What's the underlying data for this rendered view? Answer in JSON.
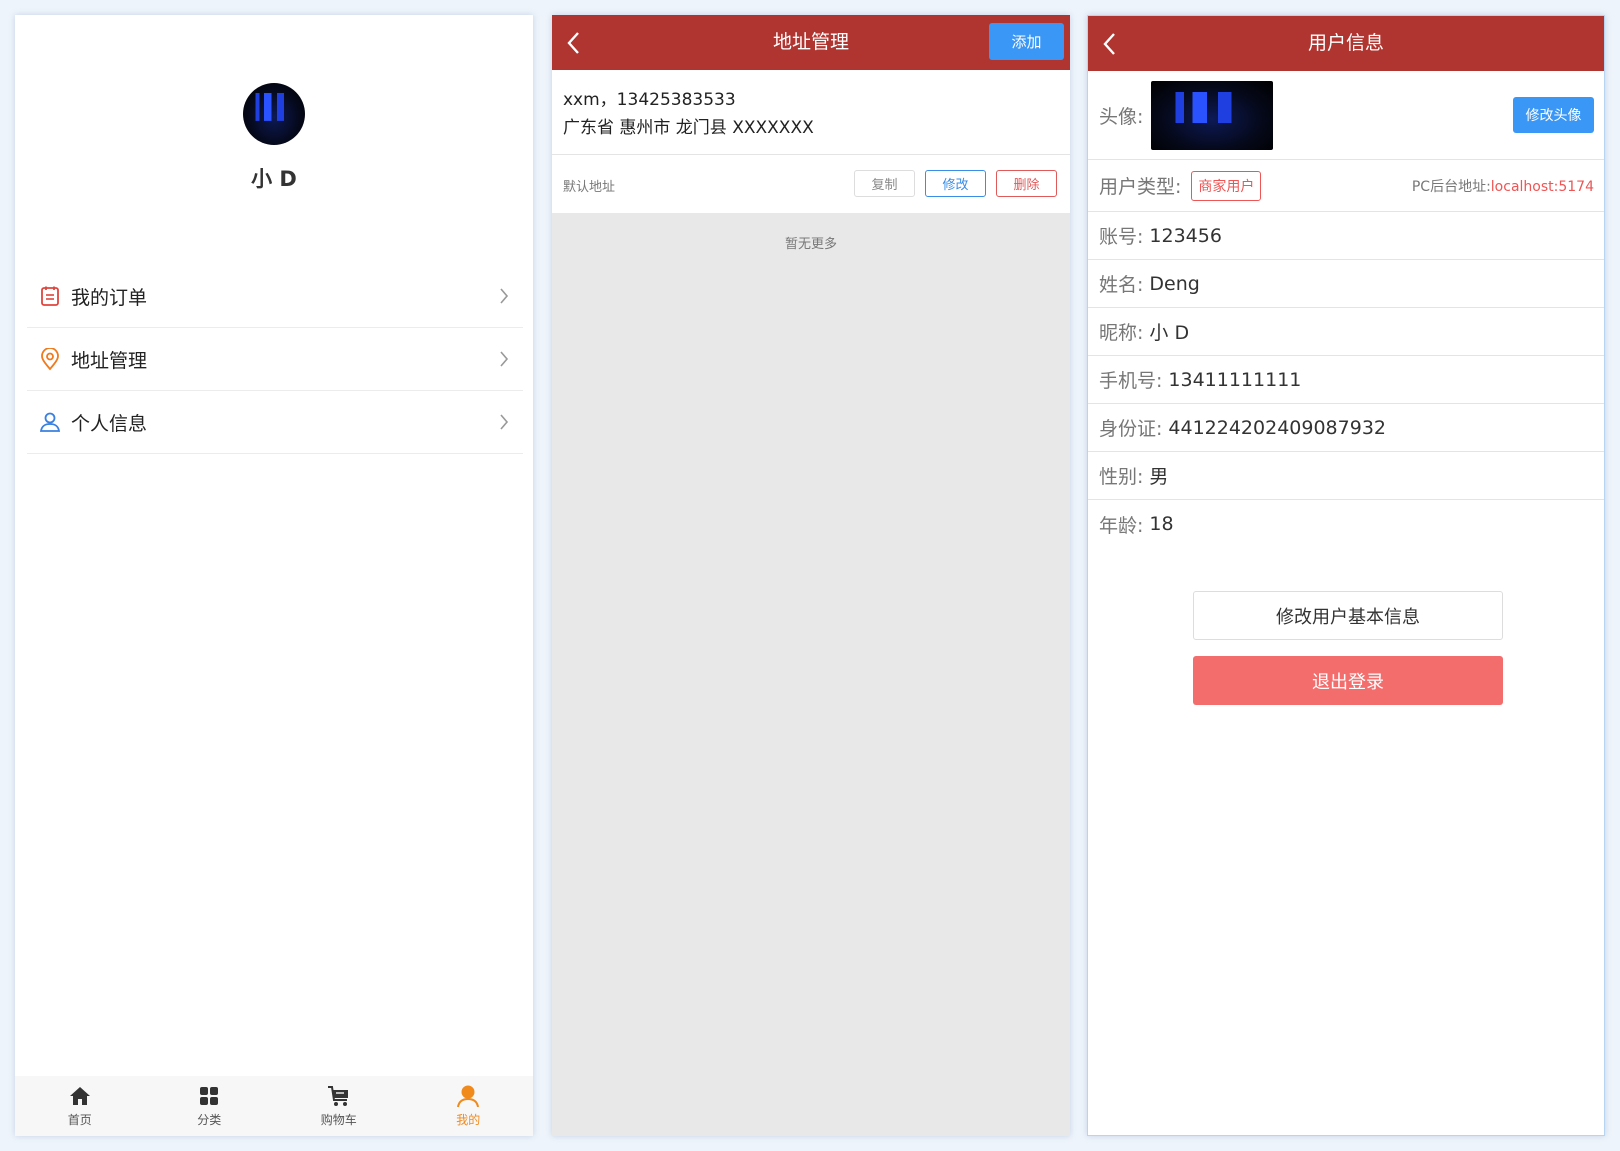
{
  "profile": {
    "username": "小 D",
    "menu": [
      {
        "label": "我的订单",
        "icon": "order-list-icon"
      },
      {
        "label": "地址管理",
        "icon": "location-pin-icon"
      },
      {
        "label": "个人信息",
        "icon": "person-icon"
      }
    ],
    "tabs": [
      {
        "label": "首页",
        "icon": "home-icon"
      },
      {
        "label": "分类",
        "icon": "grid-icon"
      },
      {
        "label": "购物车",
        "icon": "cart-icon"
      },
      {
        "label": "我的",
        "icon": "user-icon",
        "active": true
      }
    ]
  },
  "address_page": {
    "title": "地址管理",
    "add_label": "添加",
    "address": {
      "contact": "xxm，13425383533",
      "location": "广东省 惠州市 龙门县 XXXXXXX",
      "default_label": "默认地址"
    },
    "actions": {
      "copy": "复制",
      "edit": "修改",
      "delete": "删除"
    },
    "no_more": "暂无更多"
  },
  "user_page": {
    "title": "用户信息",
    "avatar_label": "头像:",
    "change_avatar": "修改头像",
    "type_label": "用户类型:",
    "type_value": "商家用户",
    "pc_label": "PC后台地址:",
    "pc_link": "localhost:5174",
    "fields": [
      {
        "label": "账号:",
        "value": "123456"
      },
      {
        "label": "姓名:",
        "value": "Deng"
      },
      {
        "label": "昵称:",
        "value": "小 D"
      },
      {
        "label": "手机号:",
        "value": "13411111111"
      },
      {
        "label": "身份证:",
        "value": "441224202409087932"
      },
      {
        "label": "性别:",
        "value": "男"
      },
      {
        "label": "年龄:",
        "value": "18"
      }
    ],
    "edit_info_label": "修改用户基本信息",
    "logout_label": "退出登录"
  },
  "colors": {
    "header": "#b0342f",
    "primary_blue": "#3a97f5",
    "danger": "#f46d6d",
    "active_tab": "#f08a1c"
  }
}
